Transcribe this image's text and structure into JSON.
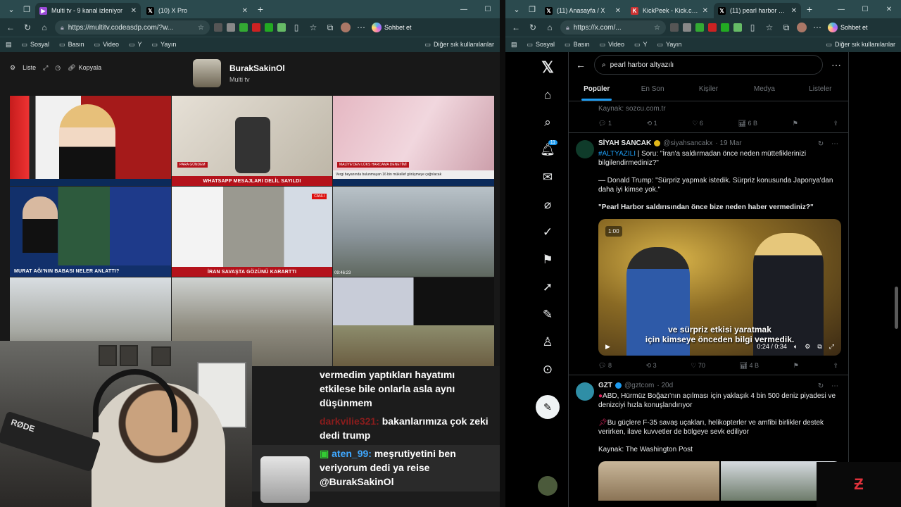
{
  "left_browser": {
    "tabs": [
      {
        "title": "Multi tv - 9 kanal izleniyor",
        "active": true
      },
      {
        "title": "(10) X Pro",
        "active": false
      }
    ],
    "url": "https://multitv.codeasdp.com/?w...",
    "sohbet_label": "Sohbet et",
    "bookmarks": [
      "Sosyal",
      "Basın",
      "Video",
      "Y",
      "Yayın"
    ],
    "bookmarks_right": "Diğer sık kullanılanlar"
  },
  "multitv": {
    "toolbar": {
      "liste": "Liste",
      "kopyala": "Kopyala"
    },
    "channel_name": "BurakSakinOl",
    "channel_sub": "Multi tv",
    "captions": [
      "",
      "WHATSAPP MESAJLARI DELİL SAYILDI",
      "Vergi beyanında bulunmayan 16 bin mükellef görüşmeye çağrılacak",
      "MURAT AĞI'NIN BABASI NELER ANLATTI?",
      "İRAN SAVAŞTA GÖZÜNÜ KARARTTI"
    ],
    "small_labels": [
      "PARA GÜNDEM",
      "MALİYE'DEN LÜKS HARCAMA DENETİMİ",
      "CANLI",
      "09:46:23"
    ]
  },
  "chat": {
    "messages": [
      {
        "user": "",
        "text": "vermedim yaptıkları hayatımı etkilese bile onlarla asla aynı düşünmem"
      },
      {
        "user": "darkvilie321:",
        "text": "bakanlarımıza çok zeki dedi trump"
      },
      {
        "user": "aten_99:",
        "text": "meşrutiyetini ben veriyorum dedi ya reise @BurakSakinOl"
      }
    ]
  },
  "right_browser": {
    "tabs": [
      {
        "title": "(11) Anasayfa / X",
        "active": false
      },
      {
        "title": "KickPeek - Kick.com için...",
        "active": false
      },
      {
        "title": "(11) pearl harbor altyazı...",
        "active": true
      }
    ],
    "url": "https://x.com/...",
    "sohbet_label": "Sohbet et",
    "bookmarks": [
      "Sosyal",
      "Basın",
      "Video",
      "Y",
      "Yayın"
    ],
    "bookmarks_right": "Diğer sık kullanılanlar"
  },
  "x": {
    "search_value": "pearl harbor altyazılı",
    "tabs": [
      "Popüler",
      "En Son",
      "Kişiler",
      "Medya",
      "Listeler"
    ],
    "notification_count": "11",
    "prev_tweet": {
      "source": "Kaynak: sozcu.com.tr",
      "replies": "1",
      "reposts": "1",
      "likes": "6",
      "views": "6 B"
    },
    "tweet1": {
      "name": "SİYAH SANCAK",
      "handle": "@siyahsancakx",
      "date": "· 19 Mar",
      "hashtag": "#ALTYAZILI",
      "line1": "| Soru: \"İran'a saldırmadan önce neden müttefiklerinizi bilgilendirmediniz?\"",
      "line2": "— Donald Trump: \"Sürpriz yapmak istedik. Sürpriz konusunda Japonya'dan daha iyi kimse yok.\"",
      "line3": "\"Pearl Harbor saldırısından önce bize neden haber vermediniz?\"",
      "video_caption1": "ve sürpriz etkisi yaratmak",
      "video_caption2": "için kimseye önceden bilgi vermedik.",
      "video_time": "0:24 / 0:34",
      "video_badge": "1:00",
      "replies": "8",
      "reposts": "3",
      "likes": "70",
      "views": "4 B"
    },
    "tweet2": {
      "name": "GZT",
      "handle": "@gztcom",
      "date": "· 20d",
      "line1": "ABD, Hürmüz Boğazı'nın açılması için yaklaşık 4 bin 500 deniz piyadesi ve denizciyi hızla konuşlandırıyor",
      "line2": "Bu güçlere F-35 savaş uçakları, helikopterler ve amfibi birlikler destek verirken, ilave kuvvetler de bölgeye sevk ediliyor",
      "line3": "Kaynak: The Washington Post"
    }
  },
  "colors": {
    "tabbar": "#2b4a4e",
    "toolbar": "#1e3437",
    "x_accent": "#1d9bf0",
    "news_red": "#b4121b"
  }
}
